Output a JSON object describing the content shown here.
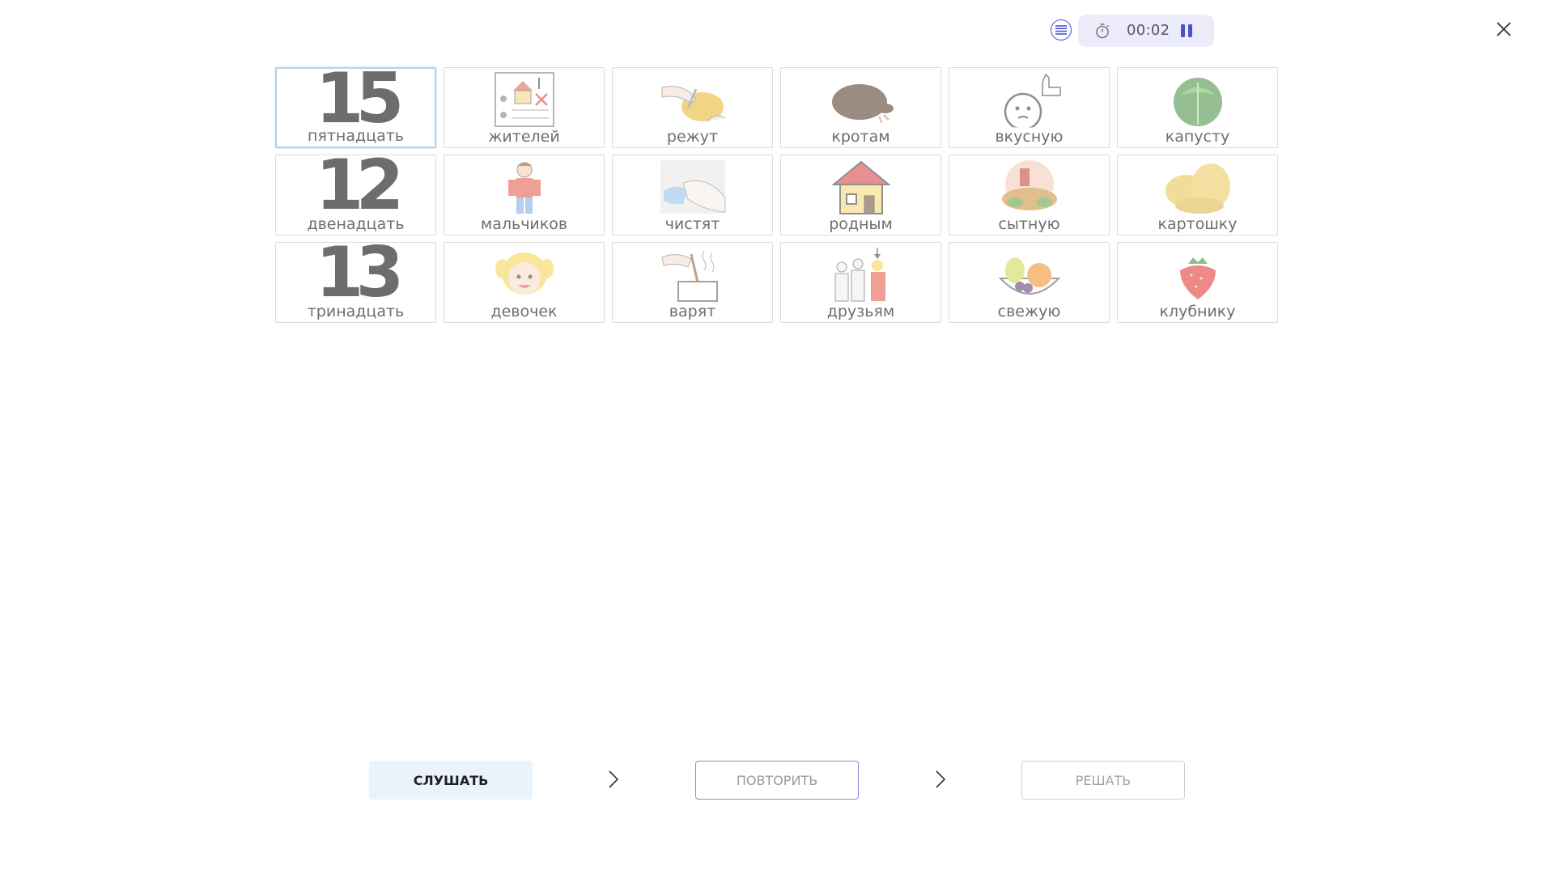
{
  "header": {
    "timer": "00:02",
    "icons": {
      "menu": "list-icon",
      "clock": "stopwatch-icon",
      "pause": "pause-icon",
      "close": "close-icon"
    }
  },
  "cards": [
    {
      "label": "пятнадцать",
      "number": "15",
      "icon": "number-15"
    },
    {
      "label": "жителей",
      "icon": "residents-list-icon"
    },
    {
      "label": "режут",
      "icon": "cutting-hands-icon"
    },
    {
      "label": "кротам",
      "icon": "mole-icon"
    },
    {
      "label": "вкусную",
      "icon": "tasty-face-icon"
    },
    {
      "label": "капусту",
      "icon": "cabbage-icon"
    },
    {
      "label": "двенадцать",
      "number": "12",
      "icon": "number-12"
    },
    {
      "label": "мальчиков",
      "icon": "boy-icon"
    },
    {
      "label": "чистят",
      "icon": "cleaning-hands-icon"
    },
    {
      "label": "родным",
      "icon": "house-icon"
    },
    {
      "label": "сытную",
      "icon": "hearty-meal-icon"
    },
    {
      "label": "картошку",
      "icon": "potato-icon"
    },
    {
      "label": "тринадцать",
      "number": "13",
      "icon": "number-13"
    },
    {
      "label": "девочек",
      "icon": "girl-icon"
    },
    {
      "label": "варят",
      "icon": "cooking-pot-icon"
    },
    {
      "label": "друзьям",
      "icon": "friends-icon"
    },
    {
      "label": "свежую",
      "icon": "fruit-bowl-icon"
    },
    {
      "label": "клубнику",
      "icon": "strawberry-icon"
    }
  ],
  "footer": {
    "listen_label": "СЛУШАТЬ",
    "repeat_label": "ПОВТОРИТЬ",
    "solve_label": "РЕШАТЬ"
  },
  "colors": {
    "accent": "#4c52d6",
    "timer_bg": "#ecebf9",
    "listen_bg": "#eaf2fb",
    "selected_border": "#b9d2ec",
    "repeat_border": "#8f86d6"
  }
}
